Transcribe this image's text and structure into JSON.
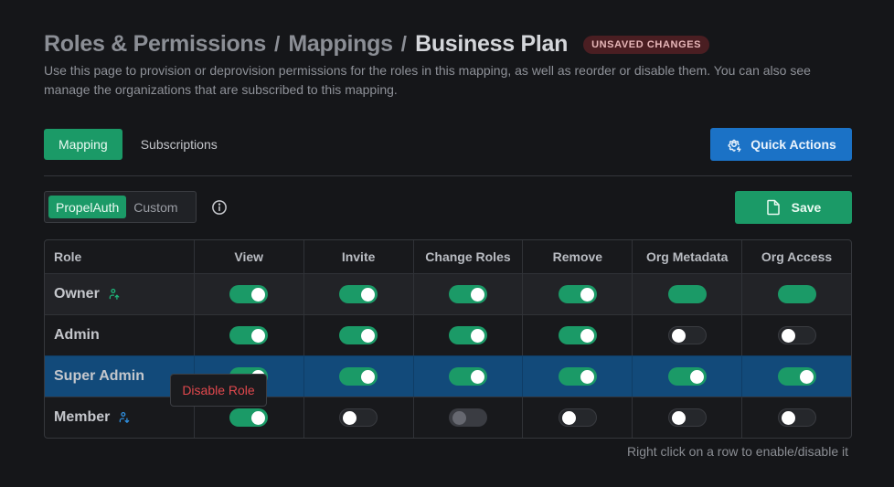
{
  "header": {
    "breadcrumbs": [
      "Roles & Permissions",
      "Mappings",
      "Business Plan"
    ],
    "separator": "/",
    "badge": "UNSAVED CHANGES",
    "description": "Use this page to provision or deprovision permissions for the roles in this mapping, as well as reorder or disable them. You can also see manage the organizations that are subscribed to this mapping."
  },
  "tabs": [
    {
      "label": "Mapping",
      "active": true
    },
    {
      "label": "Subscriptions",
      "active": false
    }
  ],
  "quick_actions": {
    "label": "Quick Actions",
    "icon": "settings-bolt-icon"
  },
  "source_toggle": {
    "options": [
      {
        "label": "PropelAuth",
        "active": true
      },
      {
        "label": "Custom",
        "active": false
      }
    ],
    "info_icon": "info-circle-icon"
  },
  "save": {
    "label": "Save",
    "icon": "file-icon"
  },
  "table": {
    "columns": [
      "Role",
      "View",
      "Invite",
      "Change Roles",
      "Remove",
      "Org Metadata",
      "Org Access"
    ],
    "rows": [
      {
        "role": "Owner",
        "icon": "user-up-icon",
        "icon_color": "#1fb57a",
        "selected": false,
        "permissions": [
          "on",
          "on",
          "on",
          "on",
          "locked",
          "locked"
        ]
      },
      {
        "role": "Admin",
        "icon": null,
        "selected": false,
        "permissions": [
          "on",
          "on",
          "on",
          "on",
          "off",
          "off"
        ]
      },
      {
        "role": "Super Admin",
        "icon": null,
        "selected": true,
        "permissions": [
          "on",
          "on",
          "on",
          "on",
          "on",
          "on"
        ]
      },
      {
        "role": "Member",
        "icon": "user-down-icon",
        "icon_color": "#2f8fe0",
        "selected": false,
        "permissions": [
          "on",
          "off",
          "disabled",
          "off",
          "off",
          "off"
        ]
      }
    ]
  },
  "context_menu": {
    "item": "Disable Role"
  },
  "hint": "Right click on a row to enable/disable it",
  "colors": {
    "accent_green": "#1b9a67",
    "accent_blue": "#1b72c6",
    "selected_row": "#124a7a",
    "danger": "#e0484d",
    "badge_bg": "#4a1e22"
  }
}
